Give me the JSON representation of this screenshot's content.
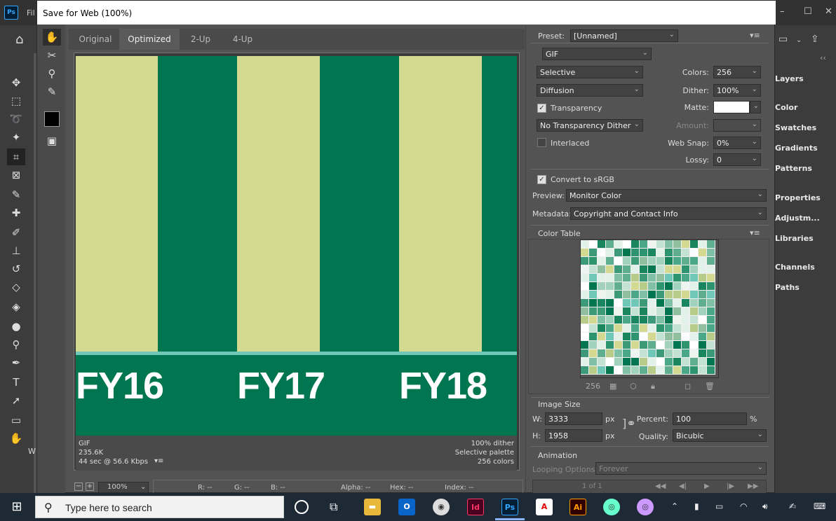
{
  "app": {
    "logo": "Ps",
    "menu_text": "Fil",
    "window_controls": [
      "–",
      "☐",
      "✕"
    ]
  },
  "ps_tools": [
    "move-tool",
    "marquee-tool",
    "lasso-tool",
    "magic-wand-tool",
    "crop-tool",
    "frame-tool",
    "eyedropper-tool",
    "healing-tool",
    "brush-tool",
    "stamp-tool",
    "history-brush-tool",
    "eraser-tool",
    "paint-bucket-tool",
    "blur-tool",
    "dodge-tool",
    "pen-tool",
    "type-tool",
    "path-selection-tool",
    "rectangle-tool",
    "hand-tool"
  ],
  "ps_panels": [
    "Layers",
    "Color",
    "Swatches",
    "Gradients",
    "Patterns",
    "Properties",
    "Adjustm...",
    "Libraries",
    "Channels",
    "Paths"
  ],
  "dialog": {
    "title": "Save for Web (100%)",
    "tabs": [
      "Original",
      "Optimized",
      "2-Up",
      "4-Up"
    ],
    "active_tab": "Optimized"
  },
  "preview": {
    "labels": [
      "FY16",
      "FY17",
      "FY18"
    ],
    "bar_color": "#d3d991",
    "bg_color": "#007650",
    "info_left": [
      "GIF",
      "235.6K",
      "44 sec @ 56.6 Kbps"
    ],
    "info_right": [
      "100% dither",
      "Selective palette",
      "256 colors"
    ],
    "zoom": "100%",
    "status": {
      "r": "R: --",
      "g": "G: --",
      "b": "B: --",
      "alpha": "Alpha: --",
      "hex": "Hex: --",
      "index": "Index: --"
    }
  },
  "settings": {
    "preset_label": "Preset:",
    "preset_value": "[Unnamed]",
    "format": "GIF",
    "reduction": "Selective",
    "dither_algo": "Diffusion",
    "colors_label": "Colors:",
    "colors_value": "256",
    "dither_label": "Dither:",
    "dither_value": "100%",
    "transparency_label": "Transparency",
    "transparency_checked": true,
    "matte_label": "Matte:",
    "transparency_dither": "No Transparency Dither",
    "amount_label": "Amount:",
    "interlaced_label": "Interlaced",
    "interlaced_checked": false,
    "websnap_label": "Web Snap:",
    "websnap_value": "0%",
    "lossy_label": "Lossy:",
    "lossy_value": "0",
    "srgb_label": "Convert to sRGB",
    "srgb_checked": true,
    "preview_label": "Preview:",
    "preview_value": "Monitor Color",
    "metadata_label": "Metadata:",
    "metadata_value": "Copyright and Contact Info",
    "color_table_label": "Color Table",
    "color_count": "256",
    "image_size_label": "Image Size",
    "w_label": "W:",
    "w_value": "3333",
    "h_label": "H:",
    "h_value": "1958",
    "px": "px",
    "percent_label": "Percent:",
    "percent_value": "100",
    "percent_unit": "%",
    "quality_label": "Quality:",
    "quality_value": "Bicubic",
    "animation_label": "Animation",
    "looping_label": "Looping Options:",
    "looping_value": "Forever",
    "frame_counter": "1 of 1"
  },
  "color_table_palette": [
    "#007650",
    "#1a8660",
    "#3d9a78",
    "#5fae90",
    "#80c0a6",
    "#a2d2bd",
    "#c4e2d4",
    "#e2f1ea",
    "#ffffff",
    "#eef4f0",
    "#d3d991",
    "#b8cc8a",
    "#8fbf9e",
    "#6fc7b8",
    "#4aa889",
    "#2e9470"
  ],
  "taskbar": {
    "search_placeholder": "Type here to search",
    "apps": [
      "Id",
      "Ps",
      "Ai"
    ]
  }
}
